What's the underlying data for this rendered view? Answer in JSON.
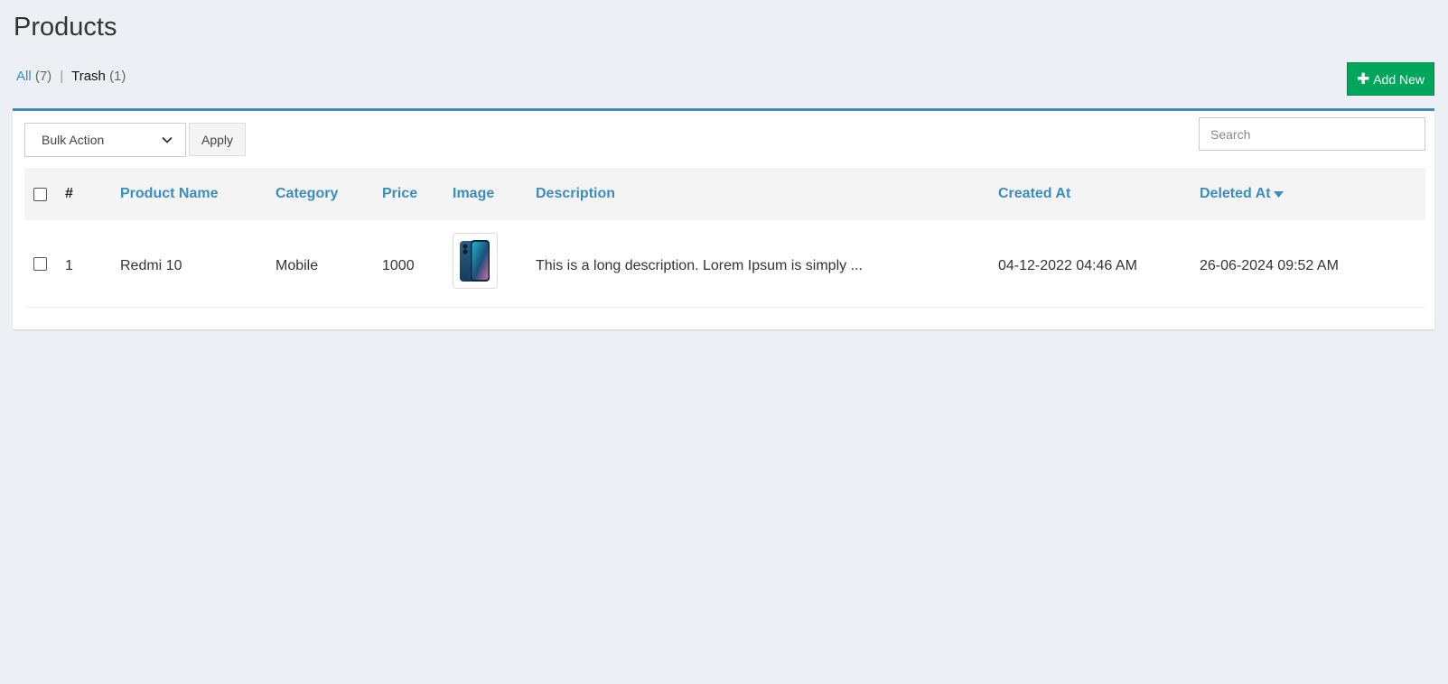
{
  "page": {
    "title": "Products"
  },
  "filters": {
    "all_label": "All",
    "all_count": "(7)",
    "separator": "|",
    "trash_label": "Trash",
    "trash_count": "(1)"
  },
  "toolbar": {
    "add_new_label": "Add New",
    "bulk_action_selected": "Bulk Action",
    "apply_label": "Apply",
    "search_placeholder": "Search"
  },
  "table": {
    "columns": [
      "#",
      "Product Name",
      "Category",
      "Price",
      "Image",
      "Description",
      "Created At",
      "Deleted At"
    ],
    "sorted_column": "Deleted At",
    "sort_direction": "descending",
    "rows": [
      {
        "index": "1",
        "product_name": "Redmi 10",
        "category": "Mobile",
        "price": "1000",
        "image_icon": "phone-thumbnail",
        "description": "This is a long description. Lorem Ipsum is simply ...",
        "created_at": "04-12-2022 04:46 AM",
        "deleted_at": "26-06-2024 09:52 AM"
      }
    ]
  },
  "colors": {
    "accent": "#3c8dbc",
    "success": "#00a65a",
    "background": "#ecf0f5"
  }
}
